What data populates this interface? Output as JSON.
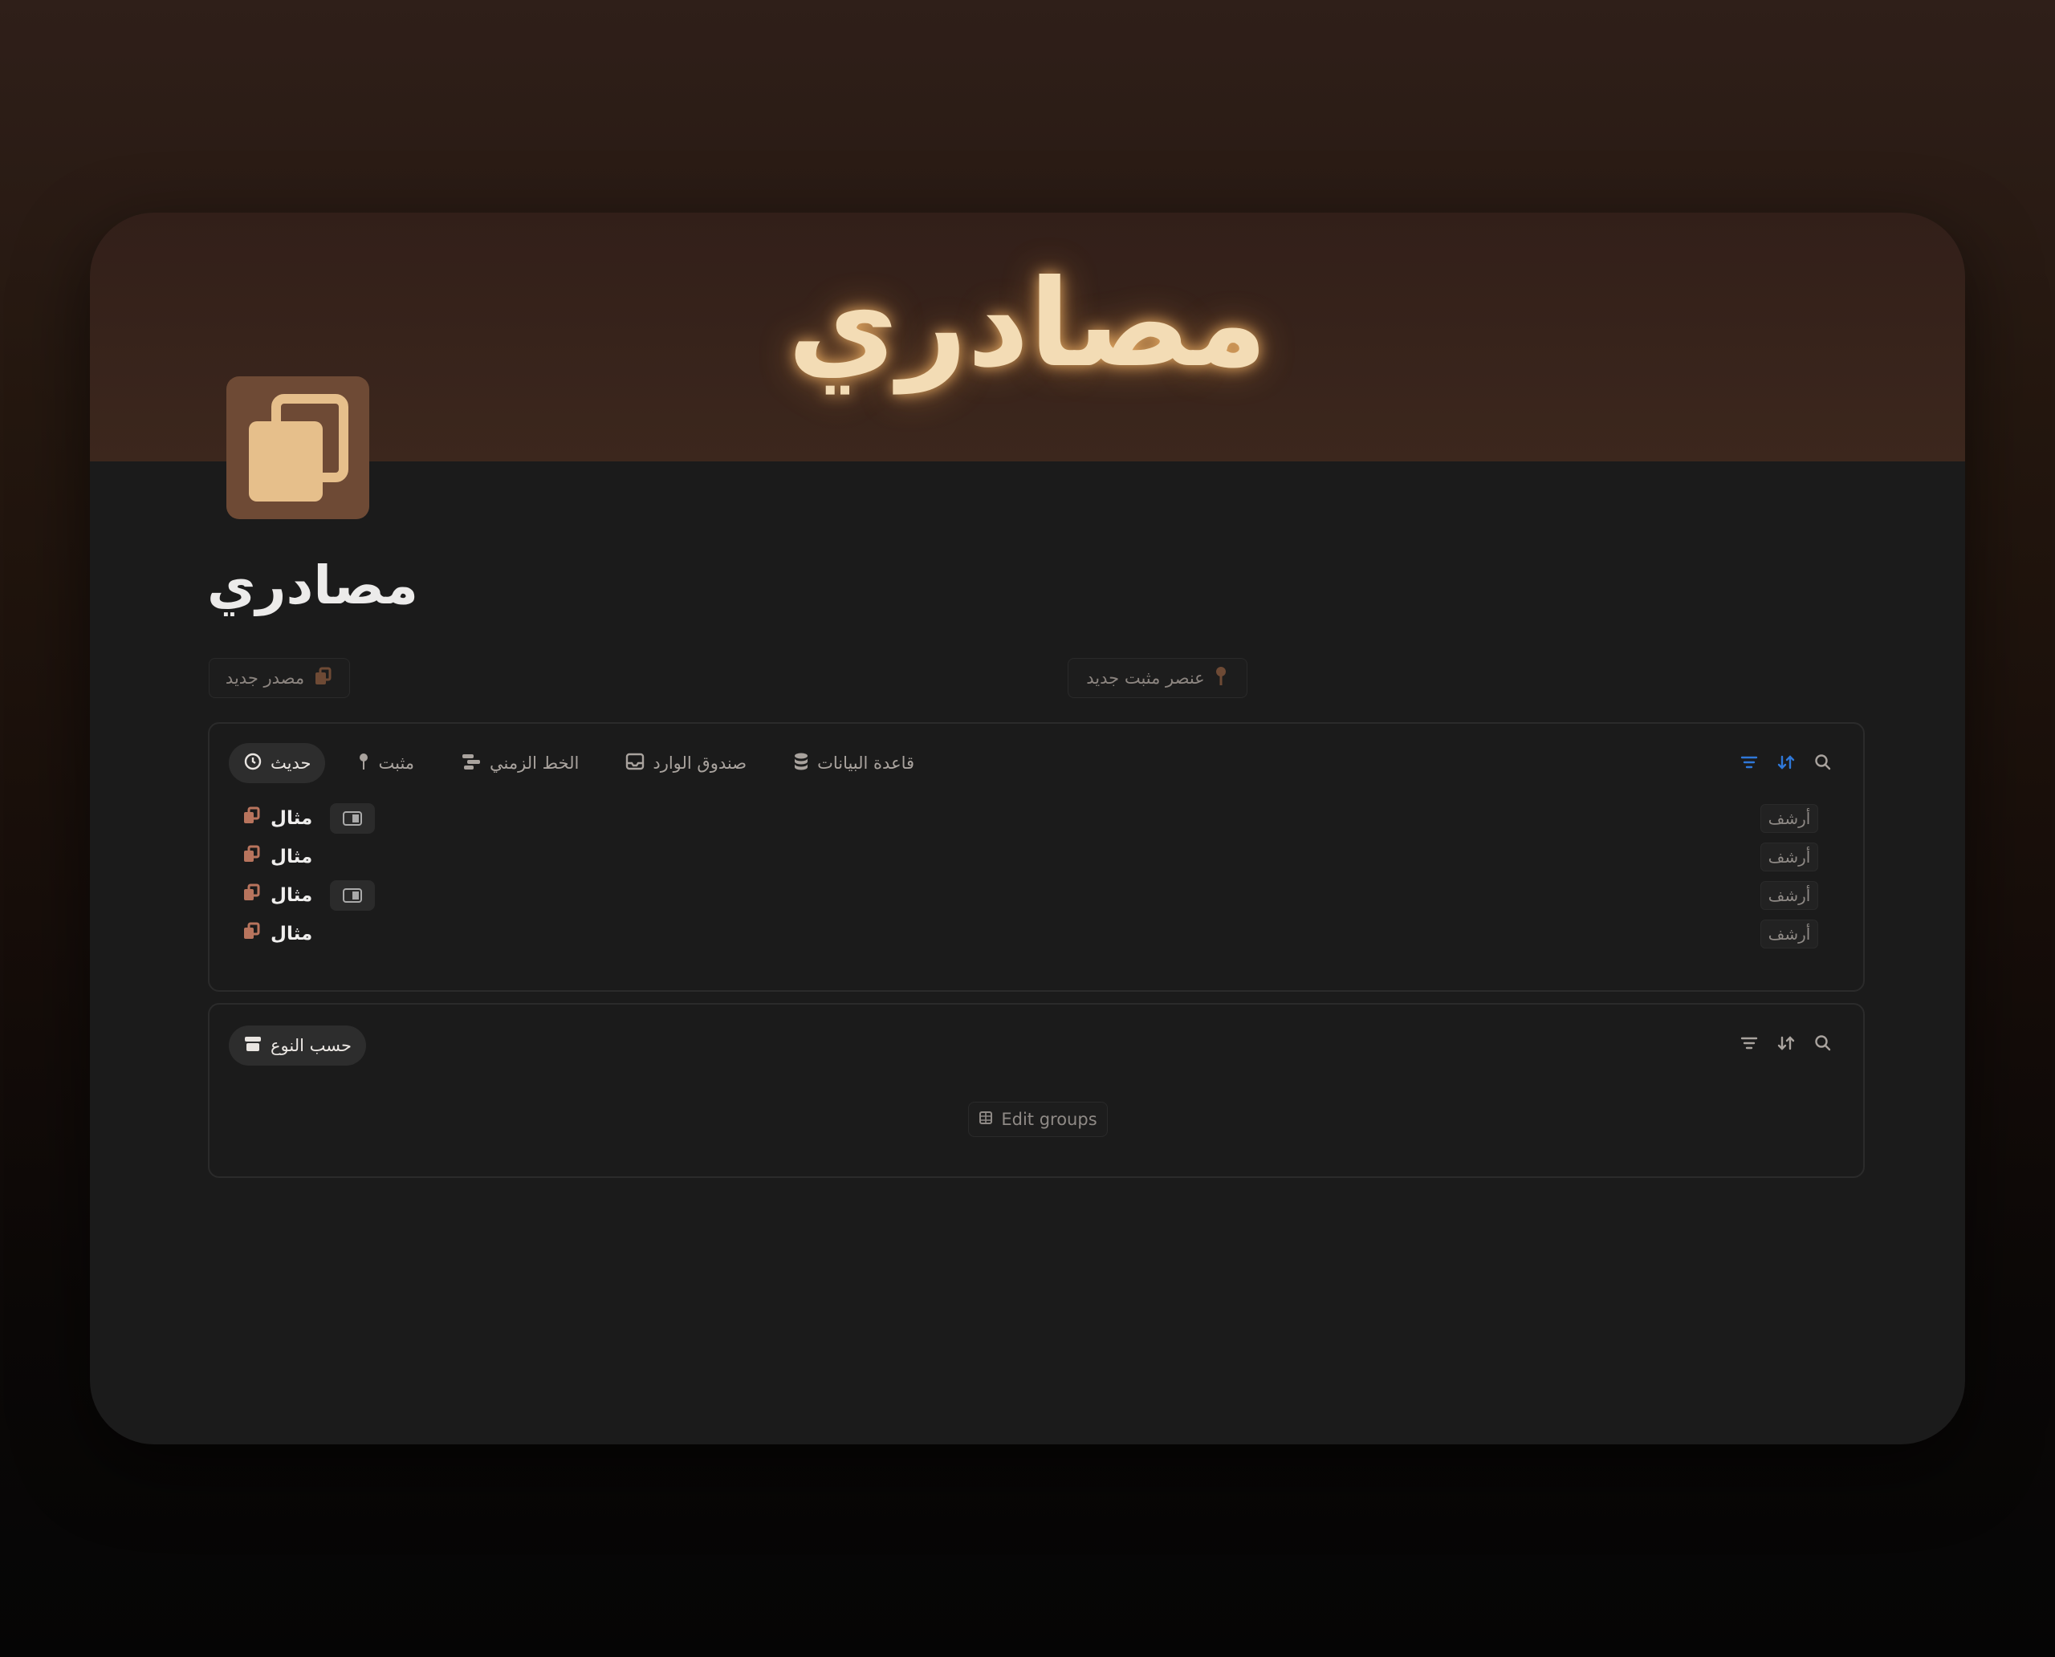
{
  "page": {
    "banner_title": "مصادري",
    "title": "مصادري",
    "icon": "copy-icon"
  },
  "actions": {
    "new_source": "مصدر جديد",
    "new_pinned": "عنصر مثبت جديد"
  },
  "views": {
    "tabs": [
      {
        "label": "حديث",
        "icon": "clock-icon",
        "active": true
      },
      {
        "label": "مثبت",
        "icon": "pin-icon",
        "active": false
      },
      {
        "label": "الخط الزمني",
        "icon": "timeline-icon",
        "active": false
      },
      {
        "label": "صندوق الوارد",
        "icon": "inbox-icon",
        "active": false
      },
      {
        "label": "قاعدة البيانات",
        "icon": "database-icon",
        "active": false
      }
    ],
    "rows": [
      {
        "label": "مثال",
        "archive": "أرشف",
        "badge": true
      },
      {
        "label": "مثال",
        "archive": "أرشف",
        "badge": false
      },
      {
        "label": "مثال",
        "archive": "أرشف",
        "badge": true
      },
      {
        "label": "مثال",
        "archive": "أرشف",
        "badge": false
      }
    ]
  },
  "groups": {
    "tab": "حسب النوع",
    "tab_icon": "archive-box-icon",
    "edit_groups": "Edit groups"
  },
  "colors": {
    "accent": "#2f78d8",
    "banner": "#3c271d",
    "icon_tile": "#6e4a35",
    "icon_fg": "#e6bf8b",
    "row_icon": "#b8745d"
  }
}
